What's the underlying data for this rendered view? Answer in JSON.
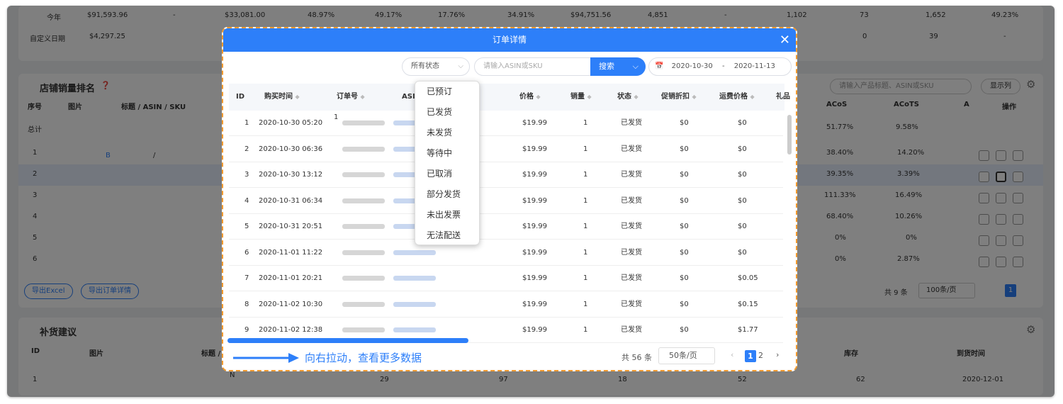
{
  "bg": {
    "summary_rows": [
      {
        "label": "今年",
        "v": [
          "$91,593.96",
          "-",
          "$33,081.00",
          "48.97%",
          "49.17%",
          "17.76%",
          "34.91%",
          "$94,751.56",
          "4,851",
          "-",
          "1,102",
          "73",
          "1,652",
          "49.23%"
        ]
      },
      {
        "label": "自定义日期",
        "v": [
          "$4,297.25",
          "",
          "",
          "",
          "",
          "",
          "",
          "",
          "",
          "",
          "",
          "0",
          "39",
          "-"
        ]
      }
    ],
    "store_title": "店铺销量排名",
    "store_headers": {
      "no": "序号",
      "img": "图片",
      "title": "标题 / ASIN / SKU",
      "acos": "ACoS",
      "acots": "ACoTS",
      "a": "A",
      "ops": "操作"
    },
    "total_label": "总计",
    "total_acos": "51.77%",
    "total_acots": "9.58%",
    "store_rows": [
      {
        "no": "1",
        "acos": "38.40%",
        "acots": "14.20%",
        "asin": "B",
        "slash": "/"
      },
      {
        "no": "2",
        "acos": "39.35%",
        "acots": "3.39%"
      },
      {
        "no": "3",
        "acos": "111.33%",
        "acots": "16.49%"
      },
      {
        "no": "4",
        "acos": "68.40%",
        "acots": "10.26%"
      },
      {
        "no": "5",
        "acos": "0%",
        "acots": "0%"
      },
      {
        "no": "6",
        "acos": "0%",
        "acots": "2.87%"
      }
    ],
    "search_placeholder": "请输入产品标题、ASIN或SKU",
    "show_cols": "显示列",
    "export_excel": "导出Excel",
    "export_orders": "导出订单详情",
    "total_count": "共 9 条",
    "page_size": "100条/页",
    "page": "1",
    "restock_title": "补货建议",
    "restock_headers": {
      "id": "ID",
      "img": "图片",
      "title": "标题 / A",
      "stock": "库存",
      "arrive": "到货时间"
    },
    "restock_row": {
      "id": "1",
      "n1": "29",
      "n2": "97",
      "n3": "18",
      "n4": "52",
      "stock": "62",
      "date": "2020-12-01",
      "n0": "N"
    }
  },
  "modal": {
    "title": "订单详情",
    "status_select": "所有状态",
    "search_placeholder": "请输入ASIN或SKU",
    "search_btn": "搜索",
    "date_from": "2020-10-30",
    "date_sep": "-",
    "date_to": "2020-11-13",
    "headers": {
      "id": "ID",
      "time": "购买时间",
      "order": "订单号",
      "asin": "ASI",
      "price": "价格",
      "qty": "销量",
      "status": "状态",
      "promo": "促销折扣",
      "ship": "运费价格",
      "gift": "礼品"
    },
    "rows": [
      {
        "id": "1",
        "time": "2020-10-30 05:20",
        "price": "$19.99",
        "qty": "1",
        "status": "已发货",
        "promo": "$0",
        "ship": "$0",
        "order": "1"
      },
      {
        "id": "2",
        "time": "2020-10-30 06:36",
        "price": "$19.99",
        "qty": "1",
        "status": "已发货",
        "promo": "$0",
        "ship": "$0"
      },
      {
        "id": "3",
        "time": "2020-10-30 13:12",
        "price": "$19.99",
        "qty": "1",
        "status": "已发货",
        "promo": "$0",
        "ship": "$0"
      },
      {
        "id": "4",
        "time": "2020-10-31 06:34",
        "price": "$19.99",
        "qty": "1",
        "status": "已发货",
        "promo": "$0",
        "ship": "$0"
      },
      {
        "id": "5",
        "time": "2020-10-31 20:51",
        "price": "$19.99",
        "qty": "1",
        "status": "已发货",
        "promo": "$0",
        "ship": "$0"
      },
      {
        "id": "6",
        "time": "2020-11-01 11:22",
        "price": "$19.99",
        "qty": "1",
        "status": "已发货",
        "promo": "$0",
        "ship": "$0"
      },
      {
        "id": "7",
        "time": "2020-11-01 20:21",
        "price": "$19.99",
        "qty": "1",
        "status": "已发货",
        "promo": "$0",
        "ship": "$0.05"
      },
      {
        "id": "8",
        "time": "2020-11-02 10:30",
        "price": "$19.99",
        "qty": "1",
        "status": "已发货",
        "promo": "$0",
        "ship": "$0.15"
      },
      {
        "id": "9",
        "time": "2020-11-02 12:38",
        "price": "$19.99",
        "qty": "1",
        "status": "已发货",
        "promo": "$0",
        "ship": "$1.77"
      }
    ],
    "dropdown": [
      "已预订",
      "已发货",
      "未发货",
      "等待中",
      "已取消",
      "部分发货",
      "未出发票",
      "无法配送"
    ],
    "hint": "向右拉动，查看更多数据",
    "total": "共 56 条",
    "page_size": "50条/页",
    "pages": [
      "1",
      "2"
    ]
  },
  "colors": {
    "accent": "#2d7ff9",
    "highlight": "#f29a2e"
  }
}
